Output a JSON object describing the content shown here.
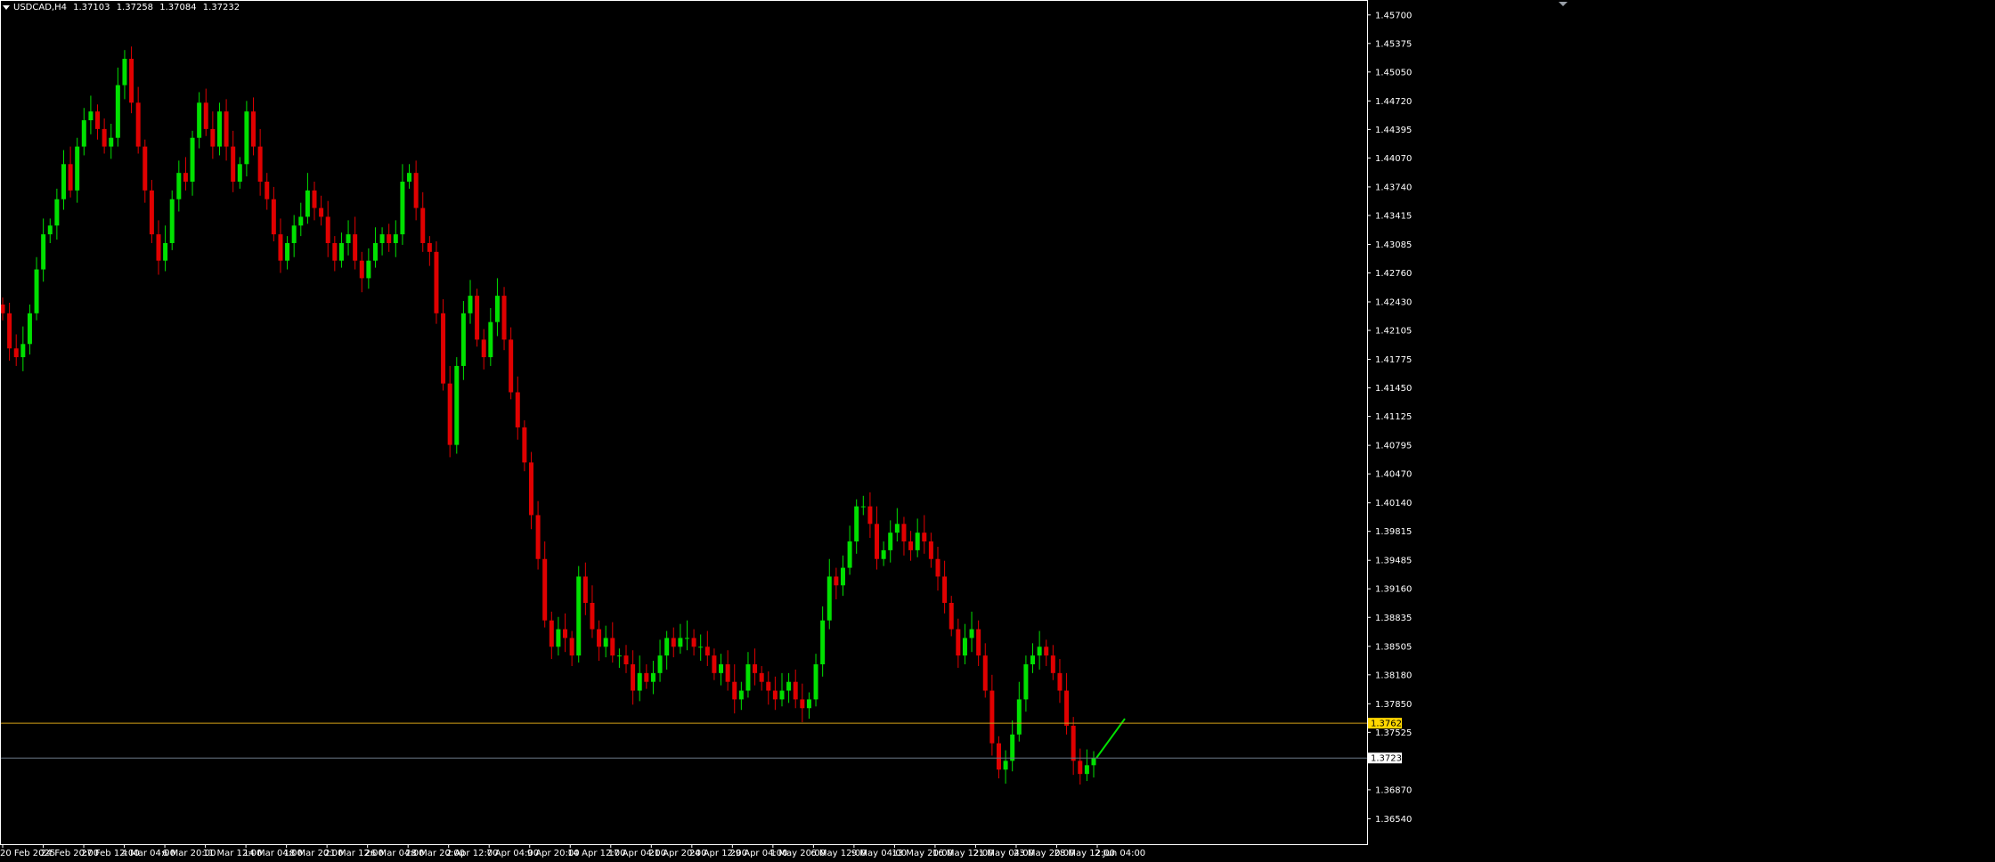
{
  "header": {
    "symbol": "USDCAD,H4",
    "open": "1.37103",
    "high": "1.37258",
    "low": "1.37084",
    "close": "1.37232"
  },
  "colors": {
    "background": "#000000",
    "axis": "#ffffff",
    "bull_candle": "#00e000",
    "bear_candle": "#e00000",
    "horizontal_line": "#d4a017",
    "bid_line": "#6e7b8b",
    "horizontal_label_bg": "#ffd700",
    "arrow": "#00e000"
  },
  "chart_data": {
    "type": "candlestick",
    "symbol": "USDCAD",
    "timeframe": "H4",
    "price_axis_labels": [
      "1.45700",
      "1.45375",
      "1.45050",
      "1.44720",
      "1.44395",
      "1.44070",
      "1.43740",
      "1.43415",
      "1.43085",
      "1.42760",
      "1.42430",
      "1.42105",
      "1.41775",
      "1.41450",
      "1.41125",
      "1.40795",
      "1.40470",
      "1.40140",
      "1.39815",
      "1.39485",
      "1.39160",
      "1.38835",
      "1.38505",
      "1.38180",
      "1.37850",
      "1.37525",
      "1.36870",
      "1.36540"
    ],
    "time_axis_labels": [
      "20 Feb 2025",
      "24 Feb 20:00",
      "27 Feb 12:00",
      "4 Mar 04:00",
      "6 Mar 20:00",
      "11 Mar 12:00",
      "14 Mar 04:00",
      "18 Mar 20:00",
      "21 Mar 12:00",
      "26 Mar 04:00",
      "28 Mar 20:00",
      "2 Apr 12:00",
      "7 Apr 04:00",
      "9 Apr 20:00",
      "14 Apr 12:00",
      "17 Apr 04:00",
      "21 Apr 20:00",
      "24 Apr 12:00",
      "29 Apr 04:00",
      "1 May 20:00",
      "6 May 12:00",
      "9 May 04:00",
      "13 May 20:00",
      "16 May 12:00",
      "21 May 04:00",
      "23 May 20:00",
      "28 May 12:00",
      "2 Jun 04:00"
    ],
    "y_range": [
      1.3625,
      1.4585
    ],
    "horizontal_line": {
      "price": 1.37629,
      "label": "1.37629"
    },
    "bid_line": {
      "price": 1.37232,
      "label": "1.37232"
    },
    "close_path": [
      1.423,
      1.419,
      1.418,
      1.4195,
      1.423,
      1.428,
      1.432,
      1.433,
      1.436,
      1.44,
      1.437,
      1.442,
      1.445,
      1.446,
      1.444,
      1.442,
      1.443,
      1.449,
      1.452,
      1.447,
      1.442,
      1.437,
      1.432,
      1.429,
      1.431,
      1.436,
      1.439,
      1.438,
      1.443,
      1.447,
      1.444,
      1.442,
      1.446,
      1.442,
      1.438,
      1.44,
      1.446,
      1.442,
      1.438,
      1.436,
      1.432,
      1.429,
      1.431,
      1.433,
      1.434,
      1.437,
      1.435,
      1.434,
      1.431,
      1.429,
      1.431,
      1.432,
      1.429,
      1.427,
      1.429,
      1.431,
      1.432,
      1.431,
      1.432,
      1.438,
      1.439,
      1.435,
      1.431,
      1.43,
      1.423,
      1.415,
      1.408,
      1.417,
      1.423,
      1.425,
      1.42,
      1.418,
      1.422,
      1.425,
      1.42,
      1.414,
      1.41,
      1.406,
      1.4,
      1.395,
      1.388,
      1.385,
      1.387,
      1.386,
      1.384,
      1.393,
      1.39,
      1.387,
      1.385,
      1.386,
      1.384,
      1.384,
      1.383,
      1.38,
      1.382,
      1.381,
      1.382,
      1.384,
      1.386,
      1.385,
      1.386,
      1.386,
      1.385,
      1.385,
      1.384,
      1.382,
      1.383,
      1.381,
      1.379,
      1.38,
      1.383,
      1.382,
      1.381,
      1.38,
      1.379,
      1.38,
      1.381,
      1.379,
      1.378,
      1.379,
      1.383,
      1.388,
      1.393,
      1.392,
      1.394,
      1.397,
      1.401,
      1.401,
      1.399,
      1.395,
      1.396,
      1.398,
      1.399,
      1.397,
      1.396,
      1.398,
      1.397,
      1.395,
      1.393,
      1.39,
      1.387,
      1.384,
      1.386,
      1.387,
      1.384,
      1.38,
      1.374,
      1.371,
      1.372,
      1.375,
      1.379,
      1.383,
      1.384,
      1.385,
      1.384,
      1.382,
      1.38,
      1.376,
      1.372,
      1.3705,
      1.3715,
      1.3723
    ],
    "projection_arrow": {
      "from": 1.37232,
      "to": 1.3768
    }
  }
}
